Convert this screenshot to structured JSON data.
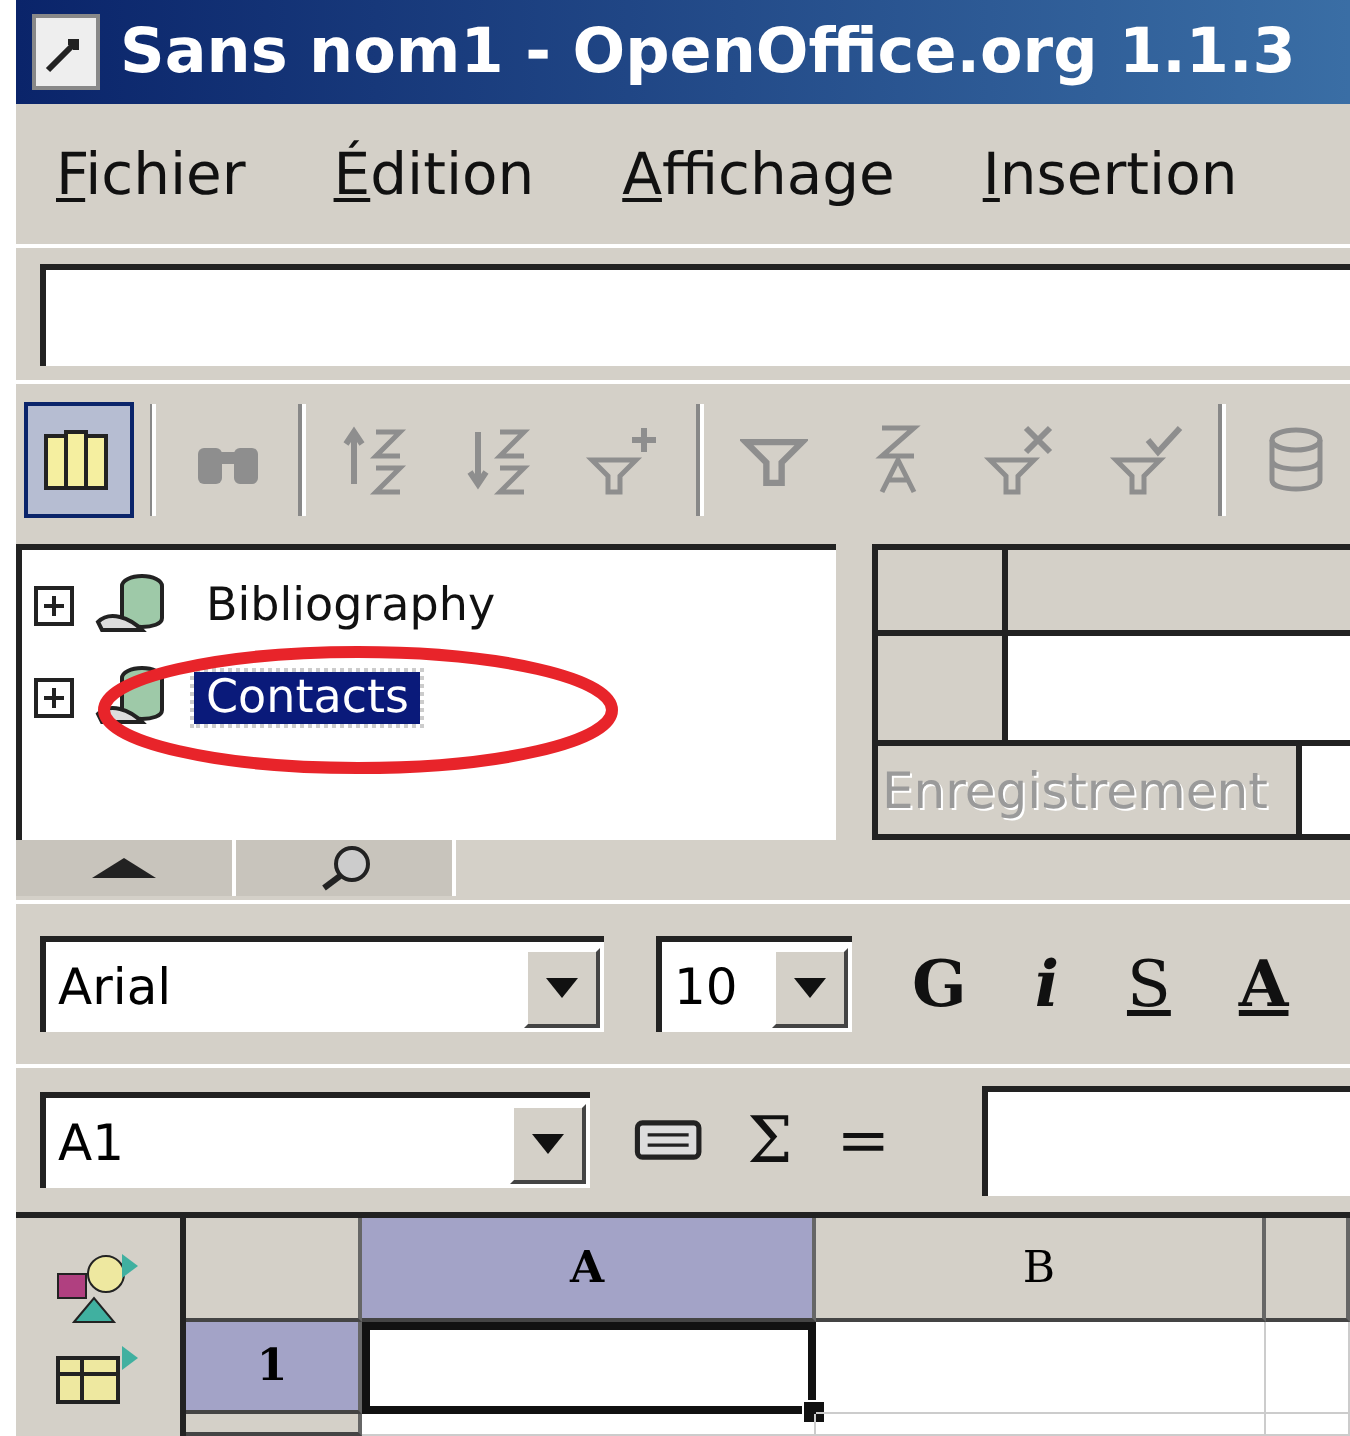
{
  "window": {
    "title": "Sans nom1 - OpenOffice.org 1.1.3"
  },
  "menu": [
    {
      "label": "Fichier"
    },
    {
      "label": "Édition"
    },
    {
      "label": "Affichage"
    },
    {
      "label": "Insertion"
    }
  ],
  "toolbar_buttons": [
    {
      "kind": "explorer",
      "pressed": true,
      "disabled": false
    },
    {
      "kind": "binoculars",
      "pressed": false,
      "disabled": true
    },
    {
      "kind": "sort_ascending",
      "pressed": false,
      "disabled": true
    },
    {
      "kind": "sort_descending",
      "pressed": false,
      "disabled": true
    },
    {
      "kind": "auto_filter",
      "pressed": false,
      "disabled": true
    },
    {
      "kind": "standard_filter",
      "pressed": false,
      "disabled": true
    },
    {
      "kind": "sort",
      "pressed": false,
      "disabled": true
    },
    {
      "kind": "remove_filter",
      "pressed": false,
      "disabled": true
    },
    {
      "kind": "apply_filter",
      "pressed": false,
      "disabled": true
    },
    {
      "kind": "database",
      "pressed": false,
      "disabled": true
    }
  ],
  "data_sources": [
    {
      "label": "Bibliography",
      "expanded": false,
      "selected": false
    },
    {
      "label": "Contacts",
      "expanded": false,
      "selected": true
    }
  ],
  "record_label": "Enregistrement",
  "formatting": {
    "font": "Arial",
    "size": "10",
    "buttons": [
      "G",
      "i",
      "S",
      "A"
    ]
  },
  "formula_bar": {
    "cell_reference": "A1",
    "sum": "Σ",
    "equals": "="
  },
  "sheet": {
    "columns": [
      {
        "label": "A",
        "selected": true
      },
      {
        "label": "B",
        "selected": false
      }
    ],
    "rows": [
      {
        "label": "1",
        "selected": true
      }
    ]
  }
}
